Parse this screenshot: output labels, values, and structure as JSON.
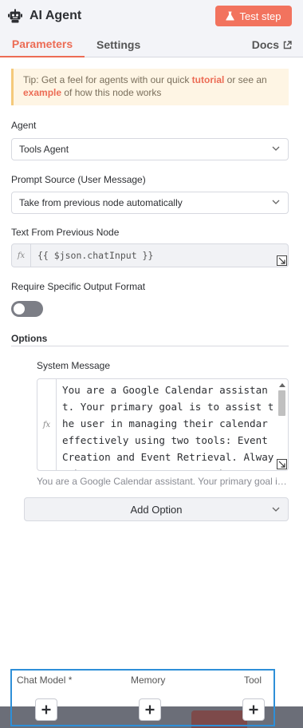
{
  "header": {
    "title": "AI Agent",
    "node_icon": "robot-icon",
    "test_button": "Test step"
  },
  "tabs": {
    "parameters": "Parameters",
    "settings": "Settings",
    "docs": "Docs"
  },
  "tip": {
    "prefix": "Tip: Get a feel for agents with our quick ",
    "link1": "tutorial",
    "middle": " or see an ",
    "link2": "example",
    "suffix": " of how this node works"
  },
  "agent": {
    "label": "Agent",
    "value": "Tools Agent"
  },
  "prompt_source": {
    "label": "Prompt Source (User Message)",
    "value": "Take from previous node automatically"
  },
  "text_from_previous": {
    "label": "Text From Previous Node",
    "fx": "fx",
    "value": "{{ $json.chatInput }}"
  },
  "require_output": {
    "label": "Require Specific Output Format",
    "enabled": false
  },
  "options": {
    "title": "Options",
    "system_message_label": "System Message",
    "system_message": "You are a Google Calendar assistant. Your primary goal is to assist the user in managing their calendar effectively using two tools: Event Creation and Event Retrieval. Always base your responses on the current date:",
    "system_message_preview": "You are a Google Calendar assistant. Your primary goal is to assist the user in managing their calendar effectively",
    "add_option": "Add Option"
  },
  "sub_nodes": {
    "chat_model": "Chat Model *",
    "memory": "Memory",
    "tool": "Tool"
  },
  "colors": {
    "accent": "#ec6c55",
    "test_button_bg": "#f2735e",
    "selection_outline": "#2e8fd8"
  }
}
